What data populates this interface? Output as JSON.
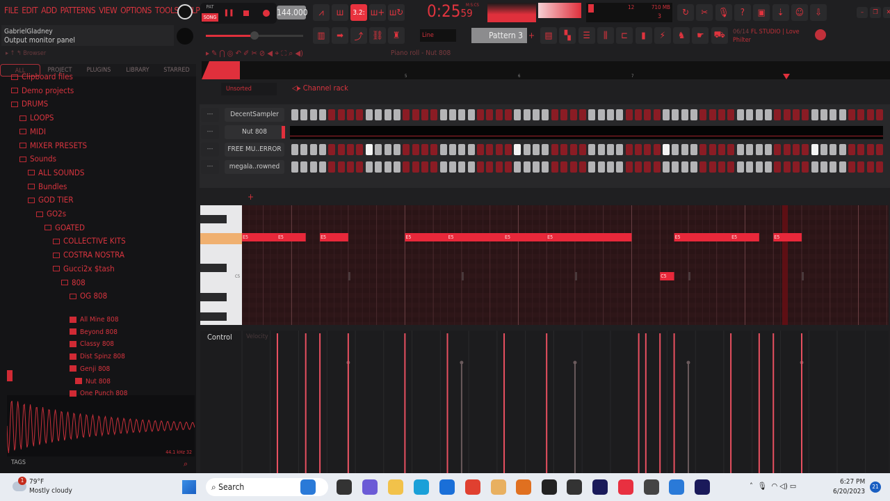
{
  "menu": [
    "FILE",
    "EDIT",
    "ADD",
    "PATTERNS",
    "VIEW",
    "OPTIONS",
    "TOOLS",
    "HELP"
  ],
  "transport": {
    "mode_pat": "PAT",
    "mode_song": "SONG",
    "tempo": "144.000",
    "time": "0:25",
    "time_sub": "59",
    "time_unit": "M:S:CS",
    "snap_label": "3.2:",
    "cpu": "12",
    "memory": "710 MB",
    "polyphony": "3"
  },
  "hint": {
    "user": "GabrielGladney",
    "text": "Output monitor panel"
  },
  "toolbar": {
    "tool_mode": "Line",
    "pattern": "Pattern 3",
    "news": "06/14",
    "news_text": "FL STUDIO | Love Philter"
  },
  "browser": {
    "title": "Browser",
    "tabs": [
      "ALL",
      "PROJECT",
      "PLUGINS",
      "LIBRARY",
      "STARRED"
    ],
    "items": [
      {
        "label": "Clipboard files",
        "type": "folder",
        "level": 0
      },
      {
        "label": "Demo projects",
        "type": "folder",
        "level": 0
      },
      {
        "label": "DRUMS",
        "type": "folder",
        "level": 0
      },
      {
        "label": "LOOPS",
        "type": "folder",
        "level": 1
      },
      {
        "label": "MIDI",
        "type": "folder",
        "level": 1
      },
      {
        "label": "MIXER PRESETS",
        "type": "folder",
        "level": 1
      },
      {
        "label": "Sounds",
        "type": "folder",
        "level": 1
      },
      {
        "label": "ALL SOUNDS",
        "type": "folder",
        "level": 2
      },
      {
        "label": "Bundles",
        "type": "folder",
        "level": 2
      },
      {
        "label": "GOD TIER",
        "type": "folder",
        "level": 2
      },
      {
        "label": "GO2s",
        "type": "folder",
        "level": 3
      },
      {
        "label": "GOATED",
        "type": "folder",
        "level": 4
      },
      {
        "label": "COLLECTIVE KITS",
        "type": "folder",
        "level": 5
      },
      {
        "label": "COSTRA NOSTRA",
        "type": "folder",
        "level": 5
      },
      {
        "label": "Gucci2x $tash",
        "type": "folder",
        "level": 5
      },
      {
        "label": "808",
        "type": "folder",
        "level": 6
      },
      {
        "label": "OG 808",
        "type": "folder",
        "level": 7
      },
      {
        "label": "All Mine 808",
        "type": "sample",
        "level": 7
      },
      {
        "label": "Beyond 808",
        "type": "sample",
        "level": 7
      },
      {
        "label": "Classy 808",
        "type": "sample",
        "level": 7
      },
      {
        "label": "Dist Spinz 808",
        "type": "sample",
        "level": 7
      },
      {
        "label": "Genji 808",
        "type": "sample",
        "level": 7
      },
      {
        "label": "Nut 808",
        "type": "sample",
        "level": 8,
        "selected": true
      },
      {
        "label": "One Punch 808",
        "type": "sample",
        "level": 7
      }
    ],
    "sample_info": "44.1 kHz 32",
    "tags": "TAGS"
  },
  "piano_roll": {
    "title": "Piano roll - Nut 808",
    "bar_labels": [
      "5",
      "6",
      "7"
    ],
    "key_label": "C5",
    "notes": [
      {
        "pitch": "E5",
        "start": 0,
        "len": 5
      },
      {
        "pitch": "E5",
        "start": 5,
        "len": 4
      },
      {
        "pitch": "E5",
        "start": 11,
        "len": 4
      },
      {
        "pitch": "E5",
        "start": 23,
        "len": 6
      },
      {
        "pitch": "E5",
        "start": 29,
        "len": 8
      },
      {
        "pitch": "E5",
        "start": 37,
        "len": 6
      },
      {
        "pitch": "E5",
        "start": 43,
        "len": 12
      },
      {
        "pitch": "C5",
        "start": 59,
        "len": 2
      },
      {
        "pitch": "E5",
        "start": 61,
        "len": 8
      },
      {
        "pitch": "E5",
        "start": 69,
        "len": 4
      },
      {
        "pitch": "E5",
        "start": 75,
        "len": 4
      }
    ],
    "ghost_steps": [
      15,
      31,
      47,
      63,
      79
    ],
    "control_label": "Control",
    "control_target": "Velocity"
  },
  "channel_rack": {
    "title": "Channel rack",
    "filter": "Unsorted",
    "channels": [
      {
        "name": "DecentSampler",
        "lit": []
      },
      {
        "name": "Nut 808",
        "piano": true
      },
      {
        "name": "FREE MU..ERROR",
        "lit": [
          8,
          24,
          40,
          56
        ]
      },
      {
        "name": "megala..rowned",
        "lit": []
      }
    ]
  },
  "taskbar": {
    "weather_temp": "79°F",
    "weather_text": "Mostly cloudy",
    "badge": "1",
    "search": "Search",
    "time": "6:27 PM",
    "date": "6/20/2023",
    "notif": "21"
  },
  "colors": {
    "accent": "#e8323e",
    "bg": "#1f1f21"
  }
}
